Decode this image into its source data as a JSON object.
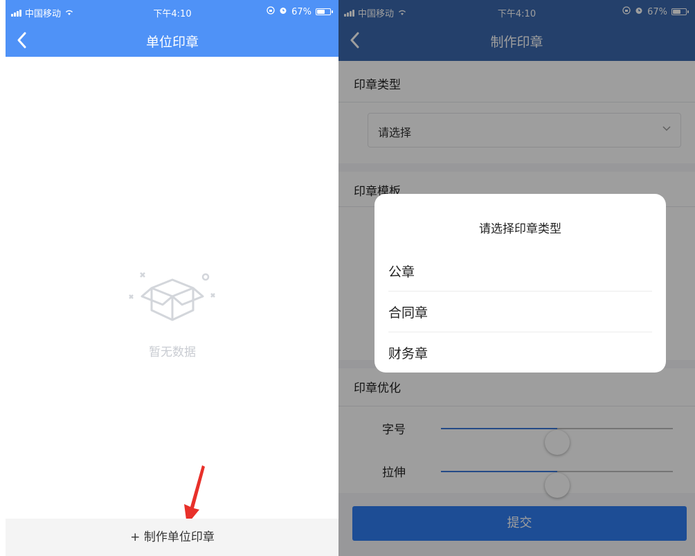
{
  "left": {
    "status_bar": {
      "carrier": "中国移动",
      "time": "下午4:10",
      "battery": "67%",
      "battery_fraction": 0.67
    },
    "header": {
      "title": "单位印章"
    },
    "empty_state": {
      "text": "暂无数据"
    },
    "bottom_action": {
      "label": "+ 制作单位印章"
    },
    "colors": {
      "primary": "#4f92f7",
      "arrow": "#e8302a"
    }
  },
  "right": {
    "status_bar": {
      "carrier": "中国移动",
      "time": "下午4:10",
      "battery": "67%",
      "battery_fraction": 0.67
    },
    "header": {
      "title": "制作印章"
    },
    "form": {
      "seal_type": {
        "label": "印章类型",
        "placeholder": "请选择"
      },
      "seal_template": {
        "label": "印章模板"
      },
      "seal_optimize": {
        "label": "印章优化",
        "sliders": [
          {
            "label": "字号",
            "value": 0.5
          },
          {
            "label": "拉伸",
            "value": 0.5
          }
        ]
      },
      "submit_label": "提交"
    },
    "dialog": {
      "title": "请选择印章类型",
      "options": [
        "公章",
        "合同章",
        "财务章"
      ]
    }
  }
}
